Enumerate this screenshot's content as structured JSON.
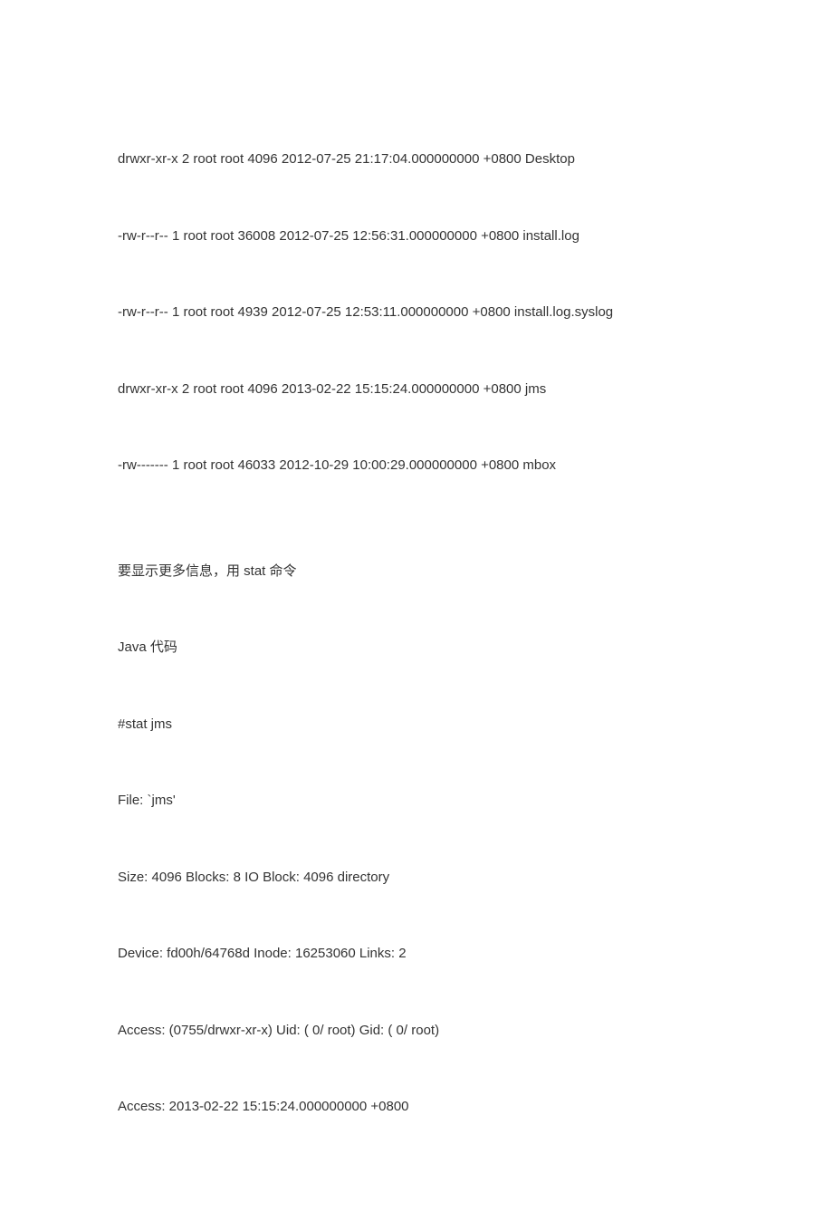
{
  "ls": {
    "l1": "drwxr-xr-x 2 root root  4096 2012-07-25 21:17:04.000000000 +0800 Desktop",
    "l2": "-rw-r--r-- 1 root root 36008 2012-07-25 12:56:31.000000000 +0800 install.log",
    "l3": "-rw-r--r-- 1 root root  4939 2012-07-25 12:53:11.000000000 +0800 install.log.syslog",
    "l4": "drwxr-xr-x 2 root root  4096 2013-02-22 15:15:24.000000000 +0800 jms",
    "l5": "-rw------- 1 root root 46033 2012-10-29 10:00:29.000000000 +0800 mbox"
  },
  "note": "要显示更多信息，用 stat 命令",
  "codeLabel": "Java 代码",
  "stat": {
    "cmd": "#stat jms",
    "file": "  File: `jms'",
    "size": "  Size: 4096            Blocks: 8          IO Block: 4096   directory",
    "device": "Device: fd00h/64768d    Inode: 16253060    Links: 2",
    "access1": "Access: (0755/drwxr-xr-x)  Uid: (    0/    root)   Gid: (    0/    root)",
    "access2": "Access: 2013-02-22 15:15:24.000000000 +0800"
  }
}
